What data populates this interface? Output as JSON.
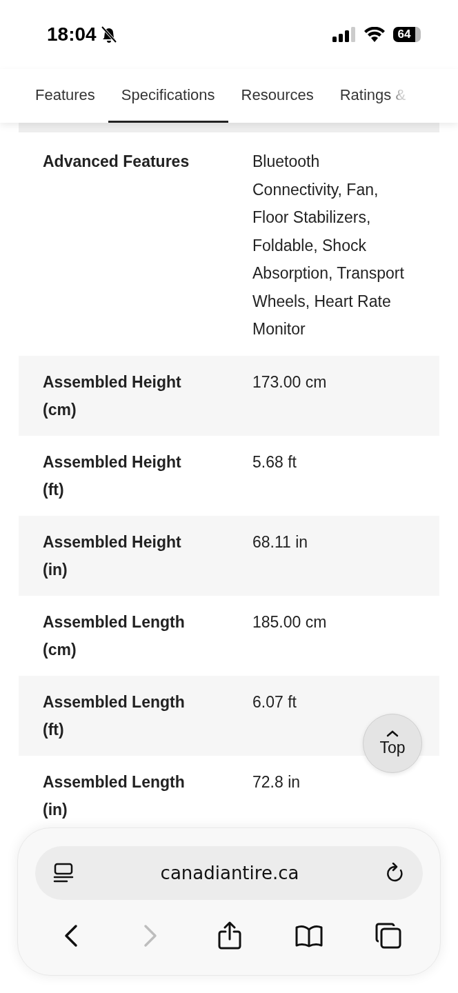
{
  "status_bar": {
    "time": "18:04",
    "silent": true,
    "battery": "64"
  },
  "tabs": [
    {
      "label": "Features",
      "selected": false
    },
    {
      "label": "Specifications",
      "selected": true
    },
    {
      "label": "Resources",
      "selected": false
    },
    {
      "label": "Ratings &",
      "selected": false
    }
  ],
  "specifications": [
    {
      "label": "Advanced Features",
      "value": "Bluetooth Connectivity, Fan, Floor Stabilizers, Foldable, Shock Absorption, Transport Wheels, Heart Rate Monitor"
    },
    {
      "label": "Assembled Height (cm)",
      "value": "173.00 cm"
    },
    {
      "label": "Assembled Height (ft)",
      "value": "5.68 ft"
    },
    {
      "label": "Assembled Height (in)",
      "value": "68.11 in"
    },
    {
      "label": "Assembled Length (cm)",
      "value": "185.00 cm"
    },
    {
      "label": "Assembled Length (ft)",
      "value": "6.07 ft"
    },
    {
      "label": "Assembled Length (in)",
      "value": "72.8 in"
    }
  ],
  "top_button": {
    "label": "Top"
  },
  "browser": {
    "url": "canadiantire.ca",
    "nav": [
      {
        "kind": "back",
        "disabled": false
      },
      {
        "kind": "forward",
        "disabled": true
      },
      {
        "kind": "share",
        "disabled": false
      },
      {
        "kind": "bookmarks",
        "disabled": false
      },
      {
        "kind": "tabs",
        "disabled": false
      }
    ]
  }
}
